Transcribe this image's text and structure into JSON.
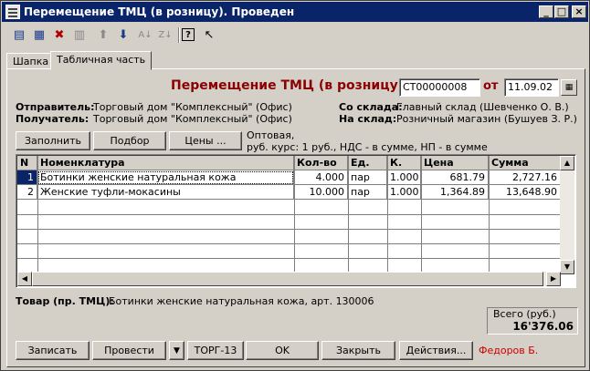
{
  "window": {
    "title": "Перемещение ТМЦ (в розницу). Проведен"
  },
  "toolbar": {
    "icons": [
      "new-row-icon",
      "copy-row-icon",
      "delete-row-icon",
      "edit-row-icon",
      "move-up-icon",
      "move-down-icon",
      "sort-asc-icon",
      "sort-desc-icon",
      "help-icon",
      "context-help-icon"
    ]
  },
  "tabs": [
    "Шапка",
    "Табличная часть"
  ],
  "header": {
    "doc_title": "Перемещение ТМЦ (в розницу) №",
    "number": "СТ00000008",
    "date_label": "от",
    "date": "11.09.02",
    "sender_label": "Отправитель:",
    "sender": "Торговый дом \"Комплексный\" (Офис)",
    "receiver_label": "Получатель:",
    "receiver": "Торговый дом \"Комплексный\" (Офис)",
    "from_wh_label": "Со склада:",
    "from_wh": "Главный склад (Шевченко О. В.)",
    "to_wh_label": "На склад:",
    "to_wh": "Розничный магазин (Бушуев З. Р.)"
  },
  "actions": {
    "fill": "Заполнить",
    "select": "Подбор",
    "prices": "Цены ...",
    "price_info_1": "Оптовая,",
    "price_info_2": "руб. курс: 1 руб., НДС - в сумме, НП - в сумме"
  },
  "table": {
    "columns": [
      "N",
      "Номенклатура",
      "Кол-во",
      "Ед.",
      "К.",
      "Цена",
      "Сумма"
    ],
    "rows": [
      {
        "n": "1",
        "name": "Ботинки женские натуральная кожа",
        "qty": "4.000",
        "unit": "пар",
        "k": "1.000",
        "price": "681.79",
        "sum": "2,727.16"
      },
      {
        "n": "2",
        "name": "Женские туфли-мокасины",
        "qty": "10.000",
        "unit": "пар",
        "k": "1.000",
        "price": "1,364.89",
        "sum": "13,648.90"
      }
    ]
  },
  "footer": {
    "item_label": "Товар (пр. ТМЦ):",
    "item_value": "Ботинки женские натуральная кожа, арт. 130006",
    "total_label": "Всего (руб.)",
    "total_value": "16'376.06"
  },
  "bottom": {
    "save": "Записать",
    "post": "Провести",
    "torg": "ТОРГ-13",
    "ok": "OK",
    "close": "Закрыть",
    "actions": "Действия...",
    "user": "Федоров Б.",
    "user_color": "#cc0000"
  }
}
